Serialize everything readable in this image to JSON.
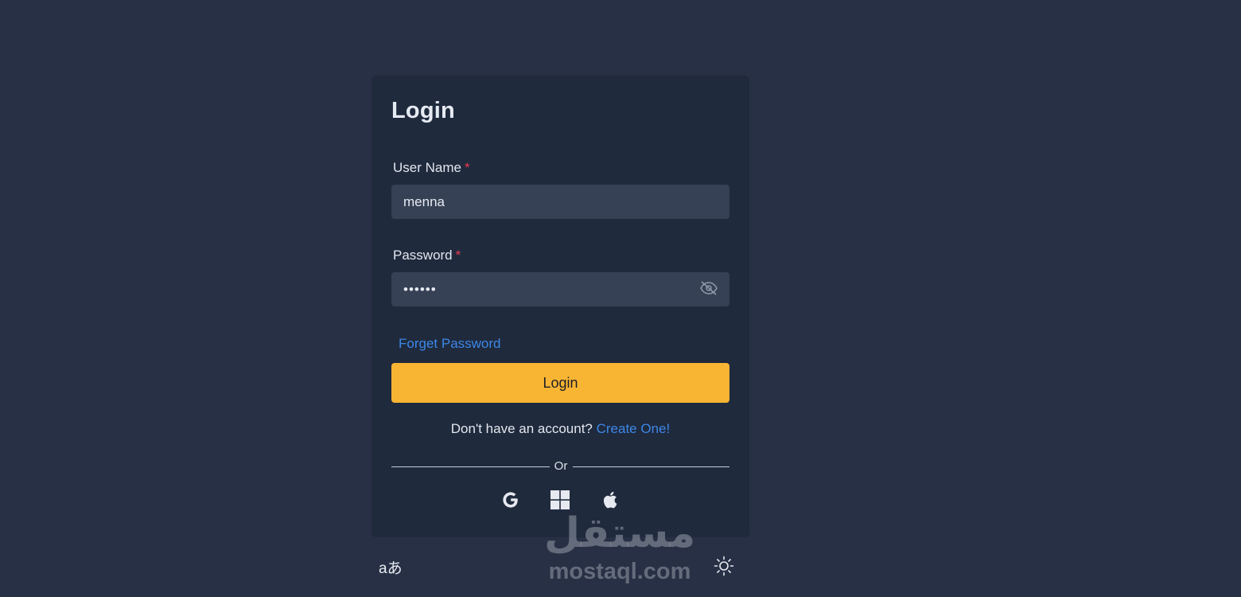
{
  "form": {
    "title": "Login",
    "username": {
      "label": "User Name",
      "required_mark": "*",
      "value": "menna"
    },
    "password": {
      "label": "Password",
      "required_mark": "*",
      "value": "••••••",
      "toggle_icon": "eye-off-icon"
    },
    "forgot_password": "Forget Password",
    "submit_label": "Login",
    "signup_prompt": "Don't have an account?",
    "signup_link": "Create One!",
    "divider_text": "Or",
    "social": [
      {
        "icon": "google-icon"
      },
      {
        "icon": "windows-icon"
      },
      {
        "icon": "apple-icon"
      }
    ]
  },
  "footer": {
    "language_toggle": "aあ",
    "theme_icon": "sun-icon"
  },
  "watermark": {
    "arabic": "مستقل",
    "latin": "mostaql.com"
  },
  "colors": {
    "background": "#283046",
    "card": "#1f2a3d",
    "input": "#364155",
    "accent": "#f8b433",
    "link": "#3d87e6",
    "required": "#ea3a4f"
  }
}
